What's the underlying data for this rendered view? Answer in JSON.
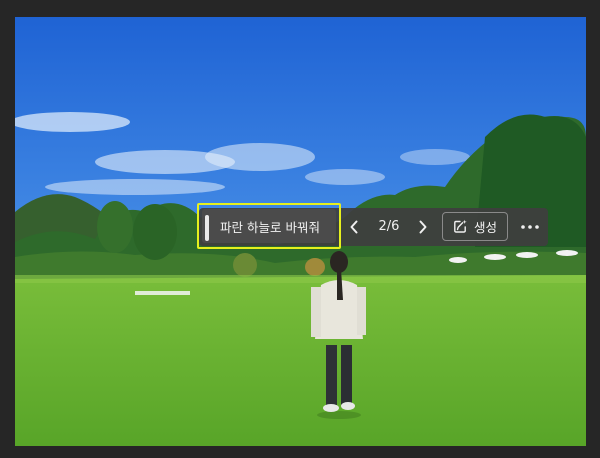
{
  "toolbar": {
    "prompt_text": "파란 하늘로 바꿔줘",
    "counter": "2/6",
    "generate_label": "생성",
    "prev_icon": "chevron-left-icon",
    "next_icon": "chevron-right-icon",
    "generate_icon": "sparkle-edit-icon",
    "more_icon": "more-horizontal-icon"
  },
  "colors": {
    "highlight_border": "#e6f01e",
    "toolbar_bg": "#3e3e3e",
    "canvas_bg": "#262626"
  }
}
